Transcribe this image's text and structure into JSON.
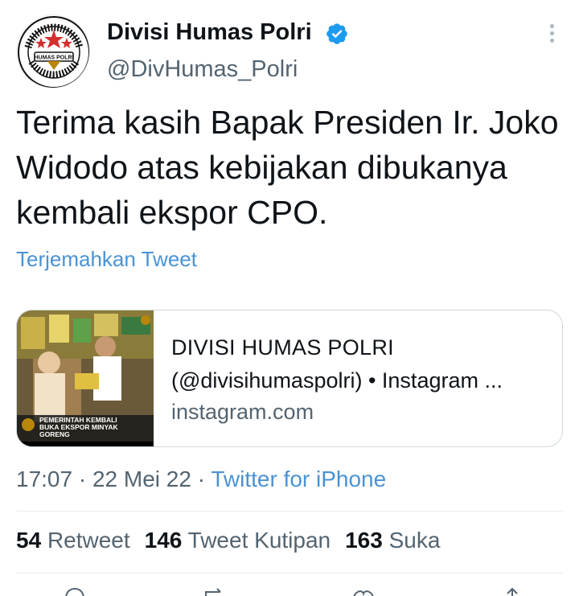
{
  "account": {
    "name": "Divisi Humas Polri",
    "handle": "@DivHumas_Polri",
    "avatar_text": {
      "top": "DIVISI HUMAS POLRI",
      "badge": "HUMAS POLRI"
    }
  },
  "tweet": {
    "text": "Terima kasih Bapak Presiden Ir. Joko Widodo atas kebijakan dibukanya kembali ekspor CPO.",
    "translate_label": "Terjemahkan Tweet"
  },
  "card": {
    "title": "DIVISI HUMAS POLRI",
    "subtitle": "(@divisihumaspolri) • Instagram ...",
    "domain": "instagram.com",
    "image_caption": "PEMERINTAH KEMBALI BUKA EKSPOR MINYAK GORENG"
  },
  "meta": {
    "time": "17:07",
    "date": "22 Mei 22",
    "separator": " · ",
    "source": "Twitter for iPhone"
  },
  "stats": {
    "retweets_count": "54",
    "retweets_label": "Retweet",
    "quotes_count": "146",
    "quotes_label": "Tweet Kutipan",
    "likes_count": "163",
    "likes_label": "Suka"
  },
  "colors": {
    "link_blue": "#4a93d4",
    "verified_blue": "#1d9bf0",
    "text_primary": "#0f1419",
    "text_secondary": "#536471"
  },
  "icons": [
    "verified-badge-icon",
    "more-options-icon",
    "reply-icon",
    "retweet-icon",
    "like-icon",
    "share-icon"
  ]
}
